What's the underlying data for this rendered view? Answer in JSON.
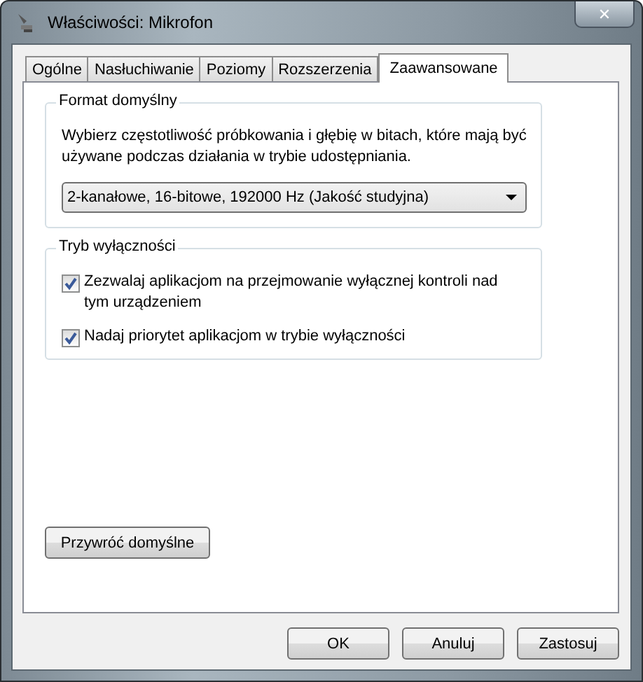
{
  "window": {
    "title": "Właściwości: Mikrofon",
    "close": "✕"
  },
  "tabs": [
    {
      "label": "Ogólne",
      "selected": false
    },
    {
      "label": "Nasłuchiwanie",
      "selected": false
    },
    {
      "label": "Poziomy",
      "selected": false
    },
    {
      "label": "Rozszerzenia",
      "selected": false
    },
    {
      "label": "Zaawansowane",
      "selected": true
    }
  ],
  "format_group": {
    "title": "Format domyślny",
    "description": "Wybierz częstotliwość próbkowania i głębię w bitach, które mają być używane podczas działania w trybie udostępniania.",
    "dropdown": {
      "value": "2-kanałowe, 16-bitowe, 192000 Hz (Jakość studyjna)"
    }
  },
  "exclusive_group": {
    "title": "Tryb wyłączności",
    "options": [
      {
        "label": "Zezwalaj aplikacjom na przejmowanie wyłącznej kontroli nad tym urządzeniem",
        "checked": true
      },
      {
        "label": "Nadaj priorytet aplikacjom w trybie wyłączności",
        "checked": true
      }
    ]
  },
  "restore_button": "Przywróć domyślne",
  "buttons": [
    "OK",
    "Anuluj",
    "Zastosuj"
  ]
}
